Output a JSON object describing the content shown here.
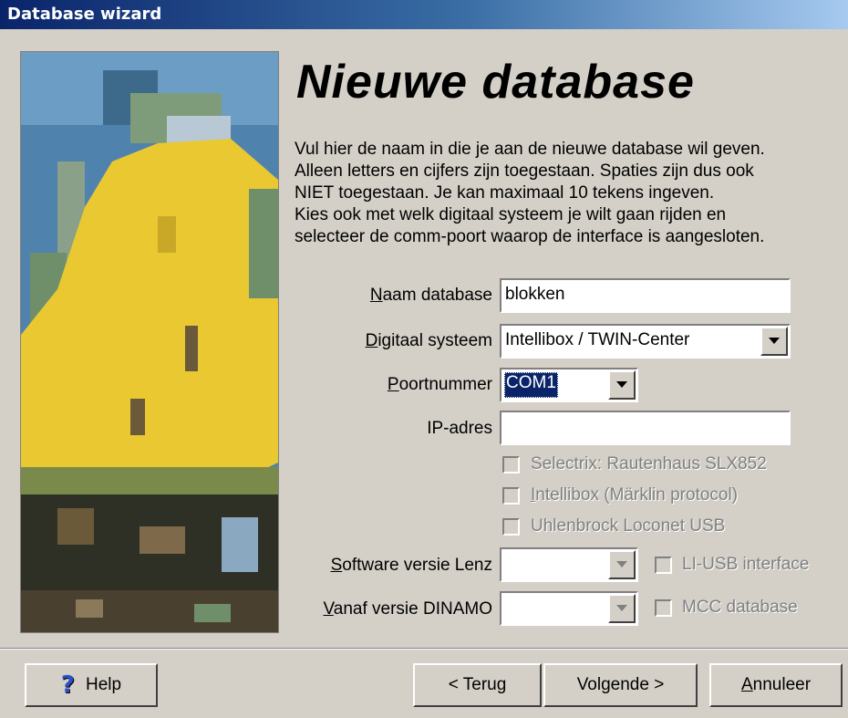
{
  "window": {
    "title": "Database wizard"
  },
  "heading": "Nieuwe database",
  "description": [
    "Vul hier de naam in die je aan de nieuwe database wil geven.",
    "Alleen letters en cijfers zijn toegestaan. Spaties zijn dus ook",
    "NIET toegestaan. Je kan maximaal 10 tekens ingeven.",
    "Kies ook met welk digitaal systeem je wilt gaan rijden en",
    "selecteer de comm-poort waarop de interface is aangesloten."
  ],
  "form": {
    "naam_label_mnemonic": "N",
    "naam_label_rest": "aam database",
    "naam_value": "blokken",
    "systeem_label_mnemonic": "D",
    "systeem_label_rest": "igitaal systeem",
    "systeem_value": "Intellibox / TWIN-Center",
    "poort_label_mnemonic": "P",
    "poort_label_rest": "oortnummer",
    "poort_value": "COM1",
    "ip_label": "IP-adres",
    "ip_value": "",
    "software_label_mnemonic": "S",
    "software_label_rest": "oftware versie Lenz",
    "software_value": "",
    "dinamo_label_mnemonic": "V",
    "dinamo_label_rest": "anaf versie DINAMO",
    "dinamo_value": ""
  },
  "checkboxes": {
    "selectrix": "Selectrix: Rautenhaus SLX852",
    "intellibox_mnemonic": "I",
    "intellibox_rest": "ntellibox (Märklin protocol)",
    "uhlenbrock": "Uhlenbrock Loconet USB",
    "liusb": "LI-USB interface",
    "mcc": "MCC database"
  },
  "buttons": {
    "help": "Help",
    "back": "< Terug",
    "next": "Volgende >",
    "cancel_mnemonic": "A",
    "cancel_rest": "nnuleer"
  },
  "icons": {
    "help": "help-question-icon",
    "dropdown": "chevron-down-icon"
  },
  "colors": {
    "title_start": "#0a246a",
    "title_end": "#a6caf0",
    "face": "#d4d0c8",
    "selection": "#0a246a"
  }
}
